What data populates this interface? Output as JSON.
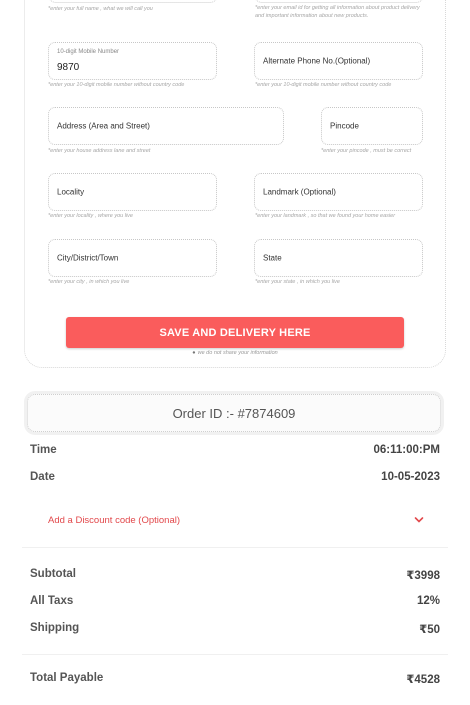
{
  "form": {
    "top_hints": {
      "name": "*enter your full name , what we will call you",
      "email": "*enter your email id for getting all information about product delivery and important information about new products."
    },
    "mobile": {
      "label": "10-digit Mobile Number",
      "value": "9870",
      "hint": "*enter your 10-digit mobile number without country code"
    },
    "alt_phone": {
      "label": "Alternate Phone No.(Optional)",
      "hint": "*enter your 10-digit mobile number without country code"
    },
    "address": {
      "label": "Address (Area and Street)",
      "hint": "*enter your house address lane and street"
    },
    "pincode": {
      "label": "Pincode",
      "hint": "*enter your pincode , must be correct"
    },
    "locality": {
      "label": "Locality",
      "hint": "*enter your locality , where you live"
    },
    "landmark": {
      "label": "Landmark (Optional)",
      "hint": "*enter your landmark , so that we found your home easier"
    },
    "city": {
      "label": "City/District/Town",
      "hint": "*enter your city , in which you live"
    },
    "state": {
      "label": "State",
      "hint": "*enter your state , in which you live"
    },
    "save_button": "SAVE AND DELIVERY HERE",
    "secure_note": "we do not share your information"
  },
  "order": {
    "id_text": "Order ID :- #7874609",
    "time_label": "Time",
    "time_value": "06:11:00:PM",
    "date_label": "Date",
    "date_value": "10-05-2023",
    "discount_label": "Add a Discount code (Optional)",
    "discount_icon": "chevron-down-icon"
  },
  "summary": {
    "subtotal_label": "Subtotal",
    "subtotal_value": "₹3998",
    "taxes_label": "All Taxs",
    "taxes_value": "12%",
    "shipping_label": "Shipping",
    "shipping_value": "₹50",
    "total_label": "Total Payable",
    "total_value": "₹4528"
  },
  "colors": {
    "accent": "#fa5c5c",
    "discount_text": "#e2484b"
  }
}
